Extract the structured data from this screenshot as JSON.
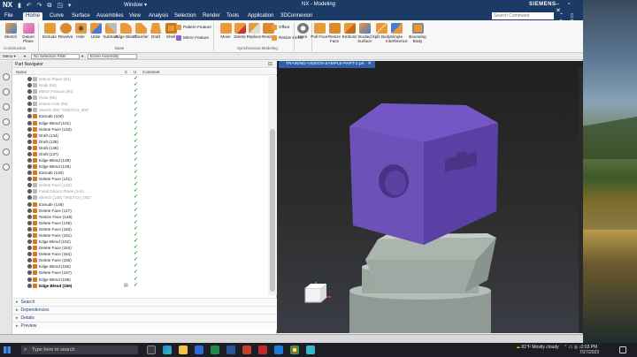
{
  "titlebar": {
    "logo": "NX",
    "quick_access": "▮ ↶ ↷ ⧉ ◳ ▾",
    "window_menu": "Window ▾",
    "title": "NX - Modeling",
    "brand": "SIEMENS",
    "controls": "– ▫ ✕"
  },
  "menubar": {
    "items": [
      "File",
      "Home",
      "Curve",
      "Surface",
      "Assemblies",
      "View",
      "Analysis",
      "Selection",
      "Render",
      "Tools",
      "Application",
      "3DConnexion"
    ],
    "active": "Home",
    "search_placeholder": "Search Command",
    "right_icons": "⌃ ▯ ⟳ ?"
  },
  "ribbon": {
    "construction": {
      "tools": [
        "Sketch",
        "Datum Plane"
      ],
      "label": "Construction"
    },
    "base": {
      "tools": [
        "Extrude",
        "Revolve",
        "Hole",
        "Unite",
        "Subtract",
        "Edge Blend",
        "Chamfer",
        "Draft",
        "Shell"
      ],
      "label": "Base"
    },
    "base_small": [
      "Pattern Feature",
      "Mirror Feature"
    ],
    "synchronous": {
      "tools": [
        "Move",
        "Delete",
        "Replace",
        "Resize"
      ],
      "small": [
        "Offset",
        "Resize Blend"
      ],
      "label": "Synchronous Modeling"
    },
    "more_label": "More",
    "surface": {
      "tools": [
        "Pull Face",
        "Resize Face",
        "Emboss",
        "Studied Surface",
        "Split Body",
        "Simple Interference",
        "Bounding Body"
      ]
    }
  },
  "selbar": {
    "menu": "Menu ▾",
    "filter": "No Selection Filter",
    "scope": "Entire Assembly"
  },
  "navigator": {
    "title": "Part Navigator",
    "columns": {
      "name": "Name",
      "c": "C",
      "u": "U",
      "comment": "Comment"
    },
    "rows": [
      {
        "label": "Datum Plane (91)",
        "style": "gray"
      },
      {
        "label": "Body (93)",
        "style": "gray"
      },
      {
        "label": "Mirror Feature (94)",
        "style": "gray"
      },
      {
        "label": "Point (95)",
        "style": "gray"
      },
      {
        "label": "Datum Axis (96)",
        "style": "gray"
      },
      {
        "label": "Sketch (99) \"SKETCH_000\"",
        "style": "gray"
      },
      {
        "label": "Extrude (100)",
        "style": ""
      },
      {
        "label": "Edge Blend (101)",
        "style": ""
      },
      {
        "label": "Delete Face (133)",
        "style": ""
      },
      {
        "label": "Draft (134)",
        "style": ""
      },
      {
        "label": "Draft (135)",
        "style": ""
      },
      {
        "label": "Draft (136)",
        "style": ""
      },
      {
        "label": "Draft (137)",
        "style": ""
      },
      {
        "label": "Edge Blend (138)",
        "style": ""
      },
      {
        "label": "Edge Blend (139)",
        "style": ""
      },
      {
        "label": "Extrude (140)",
        "style": ""
      },
      {
        "label": "Delete Face (141)",
        "style": ""
      },
      {
        "label": "Delete Face (142)",
        "style": "gray"
      },
      {
        "label": "Fixed Datum Plane (144)",
        "style": "gray"
      },
      {
        "label": "Sketch (145) \"SKETCH_001\"",
        "style": "gray"
      },
      {
        "label": "Extrude (146)",
        "style": ""
      },
      {
        "label": "Delete Face (147)",
        "style": ""
      },
      {
        "label": "Resize Face (148)",
        "style": ""
      },
      {
        "label": "Delete Face (149)",
        "style": ""
      },
      {
        "label": "Delete Face (150)",
        "style": ""
      },
      {
        "label": "Delete Face (151)",
        "style": ""
      },
      {
        "label": "Edge Blend (152)",
        "style": ""
      },
      {
        "label": "Delete Face (153)",
        "style": ""
      },
      {
        "label": "Delete Face (154)",
        "style": ""
      },
      {
        "label": "Delete Face (155)",
        "style": ""
      },
      {
        "label": "Edge Blend (156)",
        "style": ""
      },
      {
        "label": "Delete Face (157)",
        "style": ""
      },
      {
        "label": "Edge Blend (158)",
        "style": ""
      },
      {
        "label": "Edge Blend (159)",
        "style": "bold"
      }
    ],
    "sections": [
      "Search",
      "Dependencies",
      "Details",
      "Preview"
    ]
  },
  "graphics": {
    "tab_label": "TRAINING-VIDEOS-SAMPLE-PART-2.prt",
    "colors": {
      "cube": "#6b4fb8",
      "base": "#a9b4ad"
    }
  },
  "taskbar": {
    "search_placeholder": "Type here to search",
    "weather": "81°F  Mostly cloudy",
    "time": "2:03 PM",
    "date": "7/27/2023",
    "tray_icons": "⌃ ▭ ◎ ♪"
  }
}
